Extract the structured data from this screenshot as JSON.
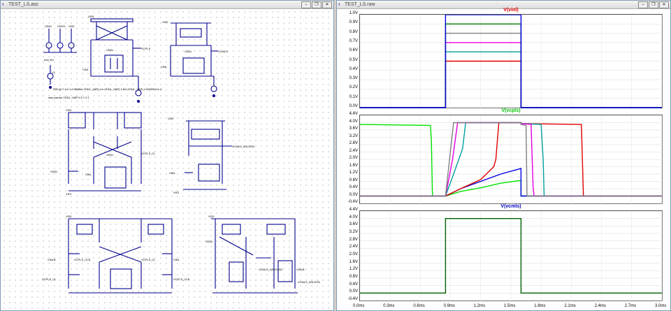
{
  "schematic_window": {
    "title": "TEST_LS.asc",
    "labels": {
      "vdd_sources": [
        "VDDL",
        "VDDH",
        "VDD"
      ],
      "v1": "V1",
      "param_line": "PWL(0 0 1m 0 0.8888m VDDL_VAR) 1m VDDL_VAR) 1.5m VDDL_VAR) 1.5000001m 0",
      "step_line": ".step param VDDL_VAR 0.5 1 0.1",
      "tran_line": ".tran 3m",
      "vdd": "VDD",
      "vddl": "VDDL",
      "vdd_b": "VDDL",
      "vinl": "VINL",
      "vcpls": "VCPLS",
      "vcmls": "VCMLS",
      "vcpls_cl": "VCPLS_CL",
      "vcpls_clb": "VCPLS_CLB",
      "vcmls_wilson": "VCMLS_WILSON",
      "vcmls_wilson2": "VCMLS_WILSON2",
      "vinlb": "VINLB",
      "vinl2": "VINL",
      "vss": "VSS"
    }
  },
  "waveform_window": {
    "title": "TEST_LS.raw"
  },
  "chart_data": [
    {
      "type": "line",
      "title": "V(vinl)",
      "title_color": "#e00000",
      "ylim": [
        0.0,
        1.0
      ],
      "yticks": [
        "1.0V",
        "0.9V",
        "0.8V",
        "0.7V",
        "0.6V",
        "0.5V",
        "0.4V",
        "0.3V",
        "0.2V",
        "0.1V",
        "0.0V"
      ],
      "x": [
        0,
        0.85,
        0.85,
        1.6,
        1.6,
        3.0
      ],
      "series": [
        {
          "color": "#e00000",
          "values": [
            0,
            0,
            0.5,
            0.5,
            0,
            0
          ]
        },
        {
          "color": "#00a0a0",
          "values": [
            0,
            0,
            0.6,
            0.6,
            0,
            0
          ]
        },
        {
          "color": "#e000e0",
          "values": [
            0,
            0,
            0.7,
            0.7,
            0,
            0
          ]
        },
        {
          "color": "#808080",
          "values": [
            0,
            0,
            0.8,
            0.8,
            0,
            0
          ]
        },
        {
          "color": "#008000",
          "values": [
            0,
            0,
            0.9,
            0.9,
            0,
            0
          ]
        },
        {
          "color": "#0000e0",
          "values": [
            0,
            0,
            1.0,
            1.0,
            0,
            0
          ]
        }
      ]
    },
    {
      "type": "line",
      "title": "V(vcpls)",
      "title_color": "#00c000",
      "ylim": [
        -0.4,
        4.4
      ],
      "yticks": [
        "4.4V",
        "4.0V",
        "3.6V",
        "3.2V",
        "2.8V",
        "2.4V",
        "2.0V",
        "1.6V",
        "1.2V",
        "0.8V",
        "0.4V",
        "0.0V",
        "-0.4V"
      ],
      "series": [
        {
          "color": "#00e000",
          "x": [
            0,
            0.7,
            0.71,
            0.72,
            0.85,
            1.0,
            1.2,
            1.4,
            1.6,
            1.6,
            3.0
          ],
          "values": [
            3.9,
            3.85,
            3.0,
            0.0,
            0.0,
            0.25,
            0.45,
            0.7,
            0.85,
            0.0,
            0.0
          ]
        },
        {
          "color": "#0000e0",
          "x": [
            0,
            0.85,
            1.0,
            1.2,
            1.4,
            1.6,
            1.6,
            3.0
          ],
          "values": [
            0,
            0,
            0.4,
            0.8,
            1.2,
            1.5,
            0.0,
            0.0
          ]
        },
        {
          "color": "#e00000",
          "x": [
            0,
            0.85,
            1.0,
            1.2,
            1.33,
            1.35,
            1.38,
            1.6,
            1.6,
            2.2,
            2.21,
            2.22,
            3.0
          ],
          "values": [
            0,
            0,
            0.4,
            0.9,
            1.6,
            2.0,
            4.0,
            4.0,
            3.95,
            3.9,
            2.0,
            0.0,
            0.0
          ]
        },
        {
          "color": "#00a0a0",
          "x": [
            0,
            0.85,
            0.95,
            1.02,
            1.05,
            1.6,
            1.6,
            1.8,
            1.82,
            1.83,
            3.0
          ],
          "values": [
            0,
            0,
            1.5,
            2.6,
            4.0,
            4.0,
            3.95,
            3.9,
            2.0,
            0.0,
            0.0
          ]
        },
        {
          "color": "#e000e0",
          "x": [
            0,
            0.85,
            0.92,
            0.97,
            1.6,
            1.6,
            1.7,
            1.72,
            1.73,
            3.0
          ],
          "values": [
            0,
            0,
            2.0,
            4.0,
            4.0,
            3.95,
            3.9,
            0.5,
            0.0,
            0.0
          ]
        },
        {
          "color": "#808080",
          "x": [
            0,
            0.85,
            0.9,
            0.93,
            1.6,
            1.6,
            1.65,
            1.66,
            3.0
          ],
          "values": [
            0,
            0,
            2.5,
            4.0,
            4.0,
            3.9,
            3.85,
            0.0,
            0.0
          ]
        }
      ]
    },
    {
      "type": "line",
      "title": "V(vcmls)",
      "title_color": "#0000c0",
      "ylim": [
        -0.4,
        4.4
      ],
      "yticks": [
        "4.4V",
        "4.0V",
        "3.6V",
        "3.2V",
        "2.8V",
        "2.4V",
        "2.0V",
        "1.6V",
        "1.2V",
        "0.8V",
        "0.4V",
        "0.0V",
        "-0.4V"
      ],
      "xticks": [
        "0.0ms",
        "0.3ms",
        "0.6ms",
        "0.9ms",
        "1.2ms",
        "1.5ms",
        "1.8ms",
        "2.1ms",
        "2.4ms",
        "2.7ms",
        "3.0ms"
      ],
      "xlim": [
        0,
        3.0
      ],
      "series": [
        {
          "color": "#006000",
          "x": [
            0,
            0.85,
            0.85,
            1.6,
            1.6,
            3.0
          ],
          "values": [
            0,
            0,
            4.0,
            4.0,
            0,
            0
          ]
        }
      ]
    }
  ]
}
